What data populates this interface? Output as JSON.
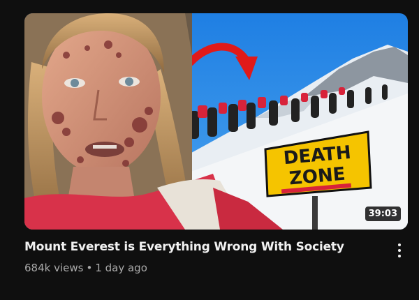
{
  "video": {
    "title": "Mount Everest is Everything Wrong With Society",
    "views": "684k views",
    "separator": "•",
    "age": "1 day ago",
    "duration": "39:03",
    "thumbnail_sign_line1": "DEATH",
    "thumbnail_sign_line2": "ZONE"
  },
  "icons": {
    "menu": "more-vert-icon"
  },
  "colors": {
    "background": "#0f0f0f",
    "title": "#f1f1f1",
    "meta": "#aaaaaa",
    "sign": "#f5c400",
    "arrow": "#e01a1a",
    "sky": "#2a86e0"
  }
}
